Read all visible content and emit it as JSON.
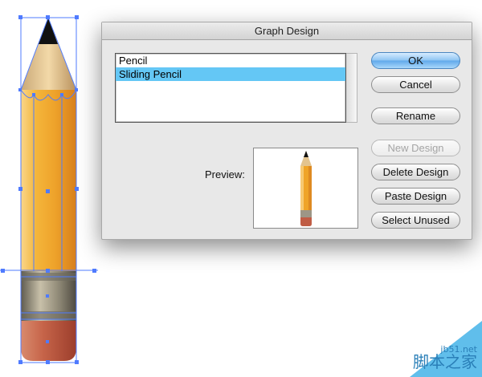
{
  "dialog": {
    "title": "Graph Design",
    "designs": [
      {
        "label": "Pencil",
        "selected": false
      },
      {
        "label": "Sliding Pencil",
        "selected": true
      }
    ],
    "preview_label": "Preview:",
    "buttons": {
      "ok": "OK",
      "cancel": "Cancel",
      "rename": "Rename",
      "new_design": "New Design",
      "delete_design": "Delete Design",
      "paste_design": "Paste Design",
      "select_unused": "Select Unused"
    },
    "selection_color": "#64c7f5"
  },
  "artwork": {
    "description_icon": "pencil-artwork",
    "colors": {
      "tip": "#111111",
      "wood": "#e3c48f",
      "body_light": "#f7c972",
      "body_mid": "#efa428",
      "body_dark": "#de8a21",
      "ferrule": "#8a8576",
      "eraser": "#c05d45",
      "selection": "#4f7bff"
    }
  },
  "watermark": {
    "url": "jb51.net",
    "text": "脚本之家"
  }
}
